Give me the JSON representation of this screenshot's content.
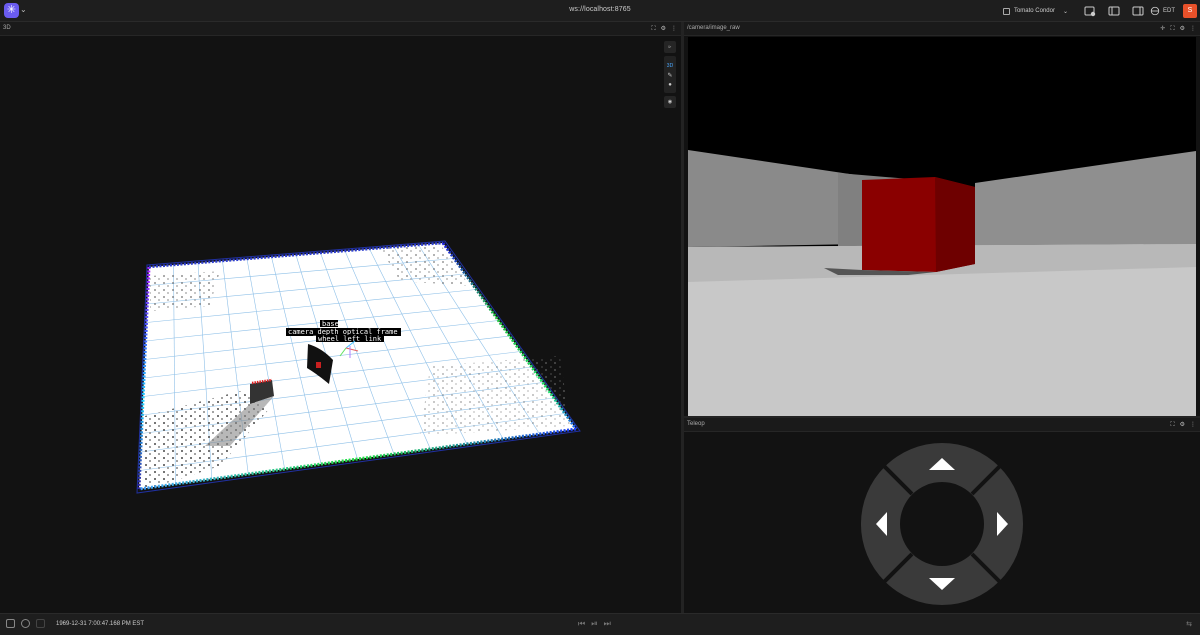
{
  "app": {
    "logo_icon": "app-logo-icon",
    "connection": "ws://localhost:8765",
    "layout_name": "Tomato Condor",
    "timezone": "EDT",
    "user_initial": "S",
    "accent": "#6b5cf0",
    "user_color": "#e8512a"
  },
  "panels": {
    "scene": {
      "title": "3D",
      "toolbar": [
        "select-icon",
        "3D",
        "ruler-icon",
        "point-icon",
        "follow-icon"
      ],
      "tool_3d_label": "3D",
      "frame_labels": [
        "base",
        "camera_depth_optical_frame",
        "wheel_left_link"
      ]
    },
    "camera": {
      "title": "/camera/image_raw"
    },
    "teleop": {
      "title": "Teleop"
    }
  },
  "playback": {
    "timestamp": "1969-12-31 7:00:47.168 PM EST"
  }
}
